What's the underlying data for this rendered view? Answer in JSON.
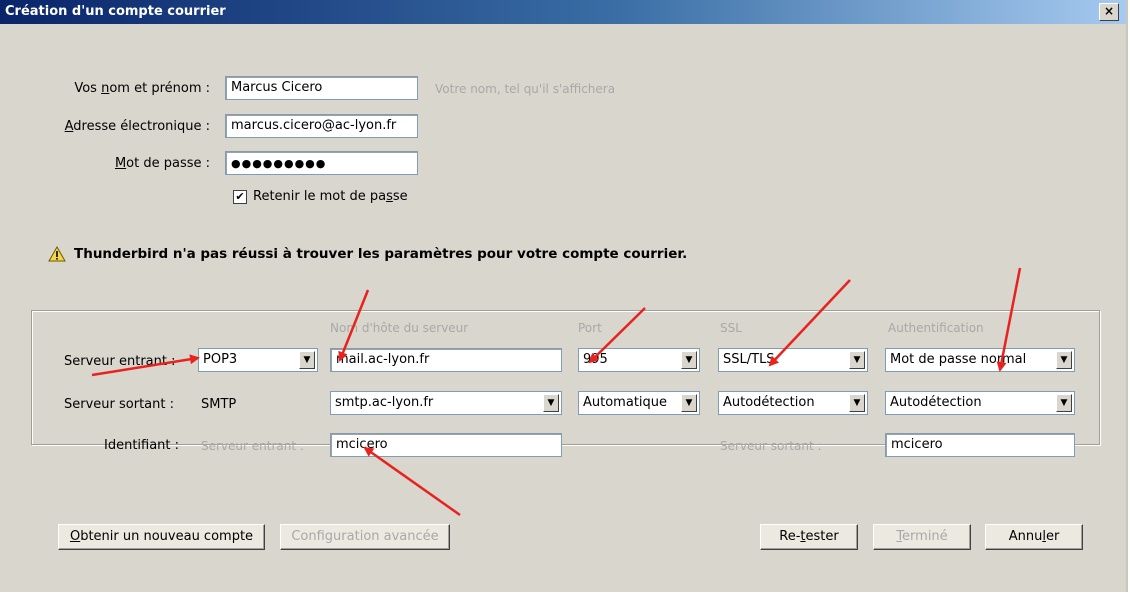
{
  "window": {
    "title": "Création d'un compte courrier",
    "close": "×"
  },
  "form": {
    "name_label_pre": "Vos ",
    "name_label_u": "n",
    "name_label_post": "om et prénom :",
    "name_value": "Marcus Cicero",
    "name_hint": "Votre nom, tel qu'il s'affichera",
    "email_label_u": "A",
    "email_label_post": "dresse électronique :",
    "email_value": "marcus.cicero@ac-lyon.fr",
    "password_label_u": "M",
    "password_label_post": "ot de passe :",
    "password_value": "●●●●●●●●●",
    "remember_pre": "Retenir le mot de pa",
    "remember_u": "s",
    "remember_post": "se",
    "remember_checked": "✔"
  },
  "warning": {
    "text": "Thunderbird n'a pas réussi à trouver les paramètres pour votre compte courrier."
  },
  "server": {
    "col_hostname": "Nom d'hôte du serveur",
    "col_port": "Port",
    "col_ssl": "SSL",
    "col_auth": "Authentification",
    "incoming_label": "Serveur entrant :",
    "incoming_type": "POP3",
    "incoming_host": "mail.ac-lyon.fr",
    "incoming_port": "995",
    "incoming_ssl": "SSL/TLS",
    "incoming_auth": "Mot de passe normal",
    "outgoing_label": "Serveur sortant :",
    "outgoing_type": "SMTP",
    "outgoing_host": "smtp.ac-lyon.fr",
    "outgoing_port": "Automatique",
    "outgoing_ssl": "Autodétection",
    "outgoing_auth": "Autodétection",
    "identifier_label": "Identifiant :",
    "identifier_in_label": "Serveur entrant :",
    "identifier_in_value": "mcicero",
    "identifier_out_label": "Serveur sortant :",
    "identifier_out_value": "mcicero"
  },
  "buttons": {
    "new_account_u": "O",
    "new_account_post": "btenir un nouveau compte",
    "advanced": "Configuration avancée",
    "retest_pre": "Re-",
    "retest_u": "t",
    "retest_post": "ester",
    "done_u": "T",
    "done_post": "erminé",
    "cancel_pre": "Annu",
    "cancel_u": "l",
    "cancel_post": "er"
  },
  "colors": {
    "arrow": "#e8231f",
    "title_bar": "#0a246a",
    "dialog_bg": "#d9d6cd"
  }
}
